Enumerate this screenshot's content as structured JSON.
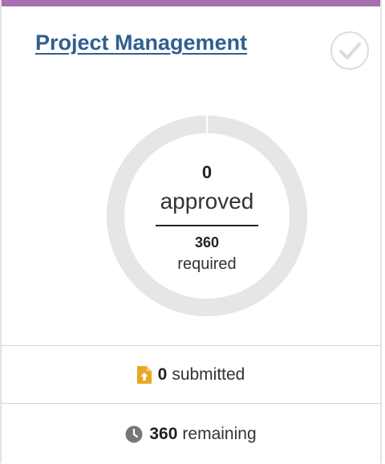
{
  "card": {
    "title": "Project Management",
    "accent_color": "#a56fb1",
    "title_color": "#2f5f8f",
    "status_icon": "check-circle-icon"
  },
  "progress": {
    "approved_count": "0",
    "approved_label": "approved",
    "required_count": "360",
    "required_label": "required",
    "approved_fraction": 0
  },
  "stats": {
    "submitted_icon": "file-upload-icon",
    "submitted_count": "0",
    "submitted_label": "submitted",
    "remaining_icon": "clock-icon",
    "remaining_count": "360",
    "remaining_label": "remaining"
  }
}
